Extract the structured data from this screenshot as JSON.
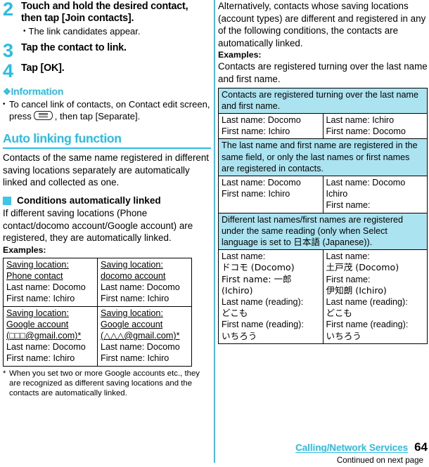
{
  "left_column": {
    "steps": [
      {
        "number": "2",
        "title": "Touch and hold the desired contact, then tap [Join contacts].",
        "sub": "The link candidates appear."
      },
      {
        "number": "3",
        "title": "Tap the contact to link.",
        "sub": ""
      },
      {
        "number": "4",
        "title": "Tap [OK].",
        "sub": ""
      }
    ],
    "information": {
      "heading": "Information",
      "diamond_icon": "❖",
      "item_part1": "To cancel link of contacts, on Contact edit screen, press",
      "key_icon": "menu-key-icon",
      "item_part2": ", then tap [Separate]."
    },
    "section": {
      "heading": "Auto linking function",
      "paragraph": "Contacts of the same name registered in different saving locations separately are automatically linked and collected as one.",
      "subheading": "Conditions automatically linked",
      "paragraph2": "If different saving locations (Phone contact/docomo account/Google account) are registered, they are automatically linked.",
      "examples_label": "Examples:"
    },
    "table": {
      "rows": [
        {
          "cells": [
            {
              "underlined": "Saving location: Phone contact",
              "lines": [
                "Last name: Docomo",
                "First name: Ichiro"
              ]
            },
            {
              "underlined": "Saving location: docomo account",
              "lines": [
                "Last name: Docomo",
                "First name: Ichiro"
              ]
            }
          ]
        },
        {
          "cells": [
            {
              "underlined": "Saving location: Google account (□□□@gmail.com)*",
              "lines": [
                "Last name: Docomo",
                "First name: Ichiro"
              ]
            },
            {
              "underlined": "Saving location: Google account (△△△@gmail.com)*",
              "lines": [
                "Last name: Docomo",
                "First name: Ichiro"
              ]
            }
          ]
        }
      ]
    },
    "footnote": {
      "marker": "*",
      "text": "When you set two or more Google accounts etc., they are recognized as different saving locations and the contacts are automatically linked."
    }
  },
  "right_column": {
    "paragraph": "Alternatively, contacts whose saving locations (account types) are different and registered in any of the following conditions, the contacts are automatically linked.",
    "examples_label": "Examples:",
    "paragraph2": "Contacts are registered turning over the last name and first name.",
    "table": {
      "sections": [
        {
          "header": "Contacts are registered turning over the last name and first name.",
          "cells": [
            [
              "Last name: Docomo",
              "First name: Ichiro"
            ],
            [
              "Last name: Ichiro",
              "First name: Docomo"
            ]
          ]
        },
        {
          "header": "The last name and first name are registered in the same field, or only the last names or first names are registered in contacts.",
          "cells": [
            [
              "Last name: Docomo",
              "First name: Ichiro"
            ],
            [
              "Last name: Docomo",
              "Ichiro",
              "First name:"
            ]
          ]
        },
        {
          "header": "Different last names/first names are registered under the same reading (only when Select language is set to 日本語 (Japanese)).",
          "cells": [
            [
              "Last name:",
              "ドコモ (Docomo)",
              "First name: 一郎 (Ichiro)",
              "Last name (reading):",
              "どこも",
              "First name (reading):",
              "いちろう"
            ],
            [
              "Last name:",
              "土戸茂 (Docomo)",
              "First name:",
              "伊知朗 (Ichiro)",
              "Last name (reading):",
              "どこも",
              "First name (reading):",
              "いちろう"
            ]
          ]
        }
      ]
    }
  },
  "footer": {
    "link": "Calling/Network Services",
    "page_number": "64",
    "continued": "Continued on next page"
  },
  "colors": {
    "accent": "#29bce4",
    "table_header": "#ace3f0",
    "divider": "#3fc3e8"
  }
}
